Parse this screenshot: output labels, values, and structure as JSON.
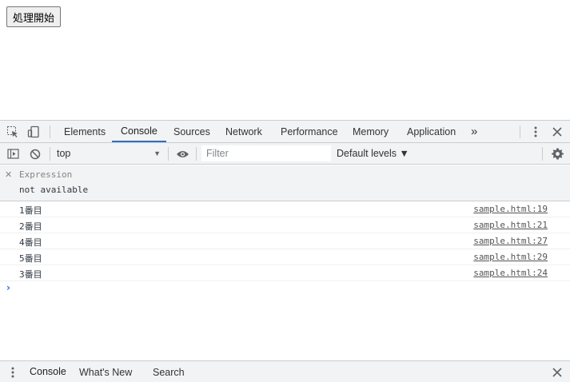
{
  "page": {
    "button_label": "処理開始"
  },
  "devtools": {
    "tabs": [
      {
        "label": "Elements"
      },
      {
        "label": "Console"
      },
      {
        "label": "Sources"
      },
      {
        "label": "Network"
      },
      {
        "label": "Performance"
      },
      {
        "label": "Memory"
      },
      {
        "label": "Application"
      }
    ],
    "more_tabs": "»",
    "active_tab": "Console",
    "icons": {
      "inspect": "inspect-element-icon",
      "device": "device-toolbar-icon",
      "menu": "kebab-menu-icon",
      "close": "close-icon"
    }
  },
  "console_toolbar": {
    "context": "top",
    "filter_placeholder": "Filter",
    "levels": "Default levels ▼",
    "icons": [
      "sidebar-toggle-icon",
      "clear-console-icon",
      "eye-icon",
      "gear-icon"
    ]
  },
  "live_expression": {
    "expression": "Expression",
    "value": "not available"
  },
  "messages": [
    {
      "text": "1番目",
      "source": "sample.html:19"
    },
    {
      "text": "2番目",
      "source": "sample.html:21"
    },
    {
      "text": "4番目",
      "source": "sample.html:27"
    },
    {
      "text": "5番目",
      "source": "sample.html:29"
    },
    {
      "text": "3番目",
      "source": "sample.html:24"
    }
  ],
  "prompt": "›",
  "drawer": {
    "tabs": [
      {
        "label": "Console"
      },
      {
        "label": "What's New"
      },
      {
        "label": "Search"
      }
    ]
  },
  "colors": {
    "accent": "#1a73e8",
    "toolbar_bg": "#f1f3f4",
    "border": "#cacdd1"
  }
}
